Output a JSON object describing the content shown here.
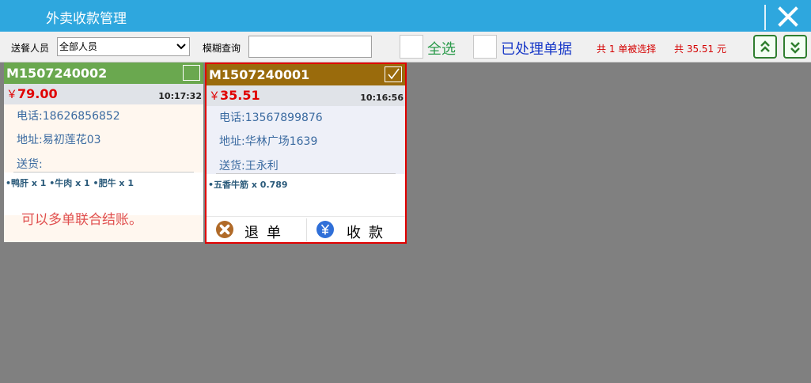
{
  "window": {
    "title": "外卖收款管理"
  },
  "toolbar": {
    "courier_label": "送餐人员",
    "courier_value": "全部人员",
    "fuzzy_label": "模糊查询",
    "fuzzy_value": "",
    "select_all_label": "全选",
    "processed_label": "已处理单据",
    "selected_count_text": "共 1 单被选择",
    "selected_total_text": "共 35.51 元"
  },
  "orders": [
    {
      "no": "M1507240002",
      "currency": "￥",
      "amount": "79.00",
      "time": "10:17:32",
      "phone": "电话:18626856852",
      "address": "地址:易初莲花03",
      "delivery": "送货:",
      "items": "•鸭肝 x 1  •牛肉 x 1  •肥牛 x 1",
      "note": "可以多单联合结账。",
      "checked": false,
      "header_color": "#6aa84f"
    },
    {
      "no": "M1507240001",
      "currency": "￥",
      "amount": "35.51",
      "time": "10:16:56",
      "phone": "电话:13567899876",
      "address": "地址:华林广场1639",
      "delivery": "送货:王永利",
      "items": "•五香牛筋 x 0.789",
      "checked": true,
      "header_color": "#9a6b0c",
      "actions": {
        "cancel": "退单",
        "collect": "收款"
      }
    }
  ],
  "colors": {
    "title_bar": "#2ea7de",
    "canvas": "#808080",
    "selected_border": "#e00000"
  }
}
